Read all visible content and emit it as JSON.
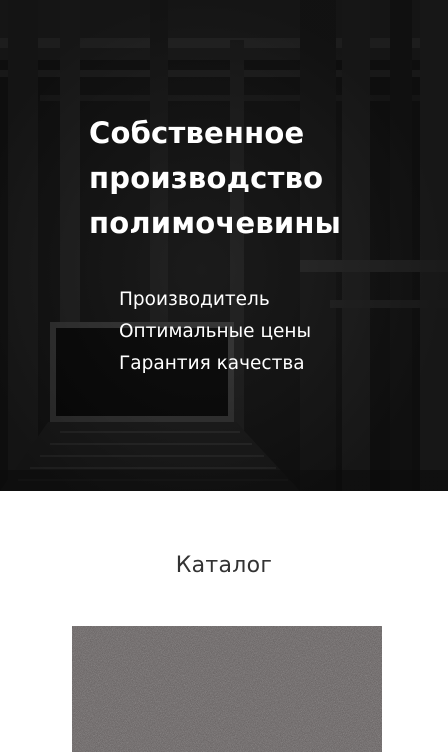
{
  "hero": {
    "title_lines": [
      "Собственное",
      "производство",
      "полимочевины"
    ],
    "features": [
      "Производитель",
      "Оптимальные цены",
      "Гарантия качества"
    ]
  },
  "catalog": {
    "title": "Каталог"
  },
  "colors": {
    "hero_text": "#ffffff",
    "section_title": "#333333",
    "page_background": "#ffffff",
    "card_texture": "#5d5757"
  }
}
